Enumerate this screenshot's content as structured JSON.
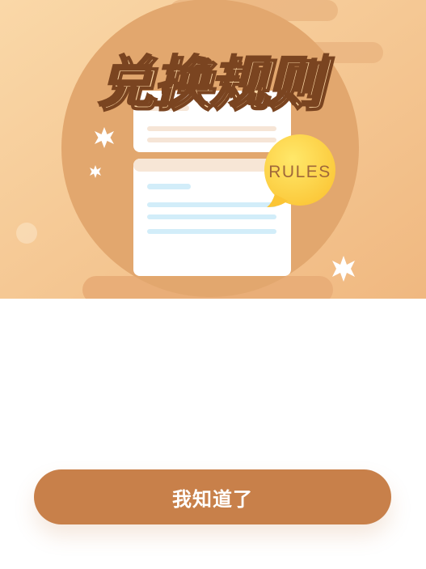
{
  "banner": {
    "title": "兑换规则",
    "badge": "RULES",
    "icons": [
      "sparkle-icon",
      "document-card-icon",
      "speech-bubble-icon"
    ]
  },
  "colors": {
    "banner_bg_light": "#f9d7a6",
    "banner_bg_dark": "#f1b982",
    "circle": "#e2a76e",
    "title": "#7a4420",
    "badge_yellow": "#fbd145",
    "badge_text": "#a0683a",
    "button": "#c8804a",
    "card_line_light": "#f6e5d6",
    "card_line_blue": "#d2edf9"
  },
  "actions": {
    "confirm_label": "我知道了"
  }
}
